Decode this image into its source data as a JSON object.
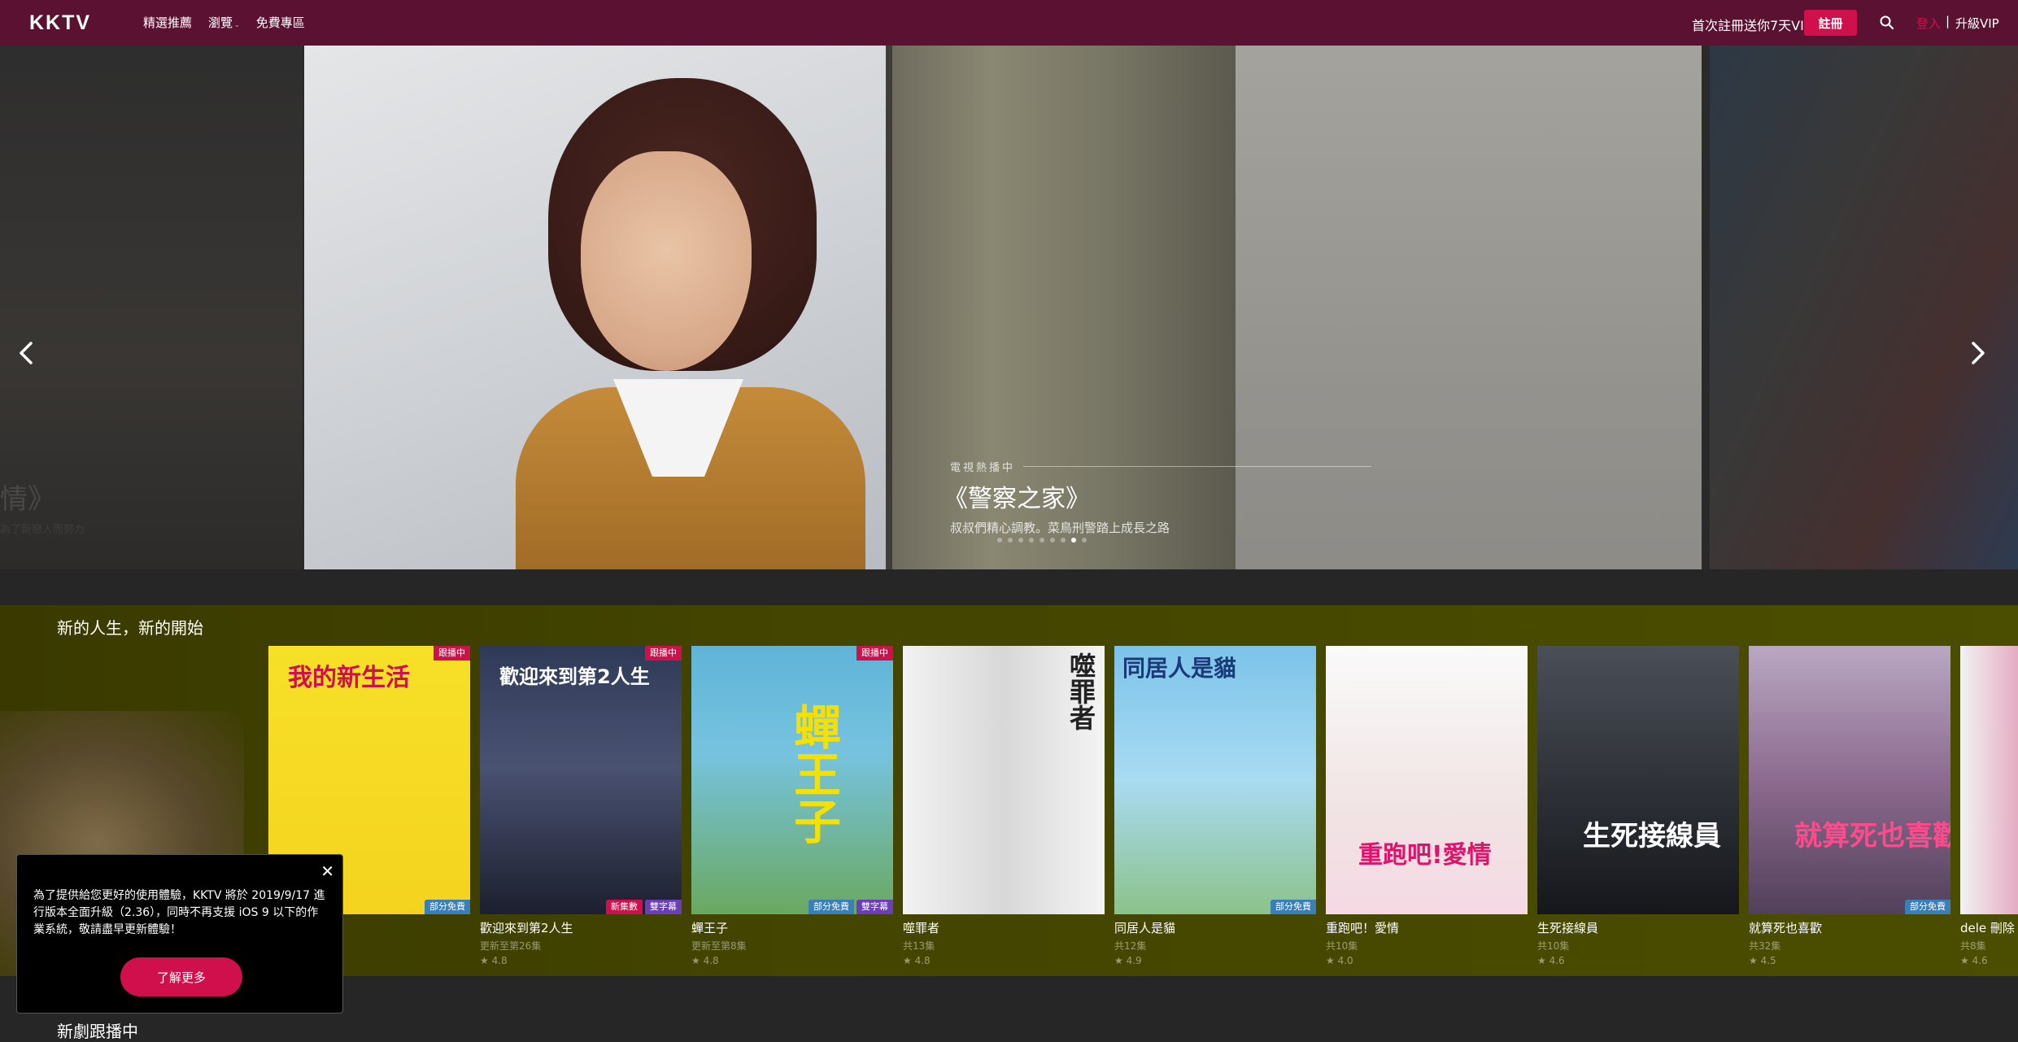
{
  "nav": {
    "logo": "KKTV",
    "links": [
      "精選推薦",
      "瀏覽",
      "免費專區"
    ],
    "browse_caret": "⌄",
    "promo": "首次註冊送你7天VIP",
    "register": "註冊",
    "login": "登入",
    "separator": "|",
    "upgrade": "升級VIP"
  },
  "hero": {
    "left_ghost": "情》",
    "left_ghost_sub": "為了新戀人而努力",
    "tag": "電視熱播中",
    "title": "《警察之家》",
    "description": "叔叔們精心調教。菜鳥刑警踏上成長之路",
    "active_slide": 7,
    "slide_count": 9
  },
  "section": {
    "title": "新的人生，新的開始",
    "cards": [
      {
        "title": "我的新生活",
        "sub": "",
        "rating": "",
        "poster_text": "我的新生活",
        "badge_tr": "跟播中",
        "badges_br": [
          {
            "label": "部分免費",
            "kind": "free"
          }
        ]
      },
      {
        "title": "歡迎來到第2人生",
        "sub": "更新至第26集",
        "rating": "★ 4.8",
        "poster_text": "歡迎來到第2人生",
        "badge_tr": "跟播中",
        "badges_br": [
          {
            "label": "新集數",
            "kind": "new"
          },
          {
            "label": "雙字幕",
            "kind": "sub"
          }
        ]
      },
      {
        "title": "蟬王子",
        "sub": "更新至第8集",
        "rating": "★ 4.8",
        "poster_text": "蟬王子",
        "badge_tr": "跟播中",
        "badges_br": [
          {
            "label": "部分免費",
            "kind": "free"
          },
          {
            "label": "雙字幕",
            "kind": "sub"
          }
        ]
      },
      {
        "title": "噬罪者",
        "sub": "共13集",
        "rating": "★ 4.8",
        "poster_text": "噬罪者",
        "badge_tr": "",
        "badges_br": []
      },
      {
        "title": "同居人是貓",
        "sub": "共12集",
        "rating": "★ 4.9",
        "poster_text": "同居人是貓",
        "badge_tr": "",
        "badges_br": [
          {
            "label": "部分免費",
            "kind": "free"
          }
        ]
      },
      {
        "title": "重跑吧！愛情",
        "sub": "共10集",
        "rating": "★ 4.0",
        "poster_text": "重跑吧!愛情",
        "badge_tr": "",
        "badges_br": []
      },
      {
        "title": "生死接線員",
        "sub": "共10集",
        "rating": "★ 4.6",
        "poster_text": "生死接線員",
        "badge_tr": "",
        "badges_br": []
      },
      {
        "title": "就算死也喜歡",
        "sub": "共32集",
        "rating": "★ 4.5",
        "poster_text": "就算死也喜歡",
        "badge_tr": "",
        "badges_br": [
          {
            "label": "部分免費",
            "kind": "free"
          }
        ]
      },
      {
        "title": "dele 刪除",
        "sub": "共8集",
        "rating": "★ 4.6",
        "poster_text": "",
        "badge_tr": "",
        "badges_br": []
      }
    ]
  },
  "cookie": {
    "text": "為了提供給您更好的使用體驗，KKTV 將於 2019/9/17 進行版本全面升級（2.36），同時不再支援 iOS 9 以下的作業系統，敬請盡早更新體驗！",
    "button": "了解更多",
    "close": "✕"
  },
  "section2": {
    "title": "新劇跟播中"
  },
  "colors": {
    "nav_bg": "#5b1131",
    "accent": "#d0104c",
    "section_bg": "#434500"
  }
}
